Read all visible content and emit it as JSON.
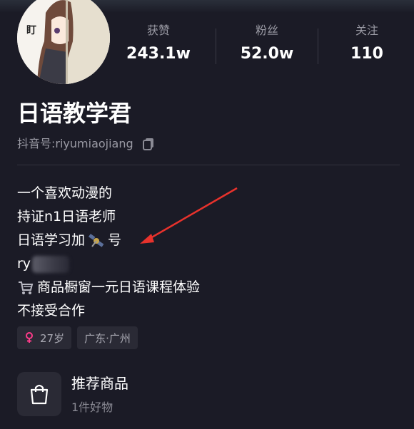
{
  "profile": {
    "avatar_text": "盯",
    "name": "日语教学君",
    "account_label": "抖音号:",
    "account_id": "riyumiaojiang"
  },
  "stats": [
    {
      "label": "获赞",
      "value": "243.1w"
    },
    {
      "label": "粉丝",
      "value": "52.0w"
    },
    {
      "label": "关注",
      "value": "110"
    }
  ],
  "bio": {
    "line1": "一个喜欢动漫的",
    "line2": "持证n1日语老师",
    "line3_before": "日语学习加",
    "line3_after": "号",
    "line4_prefix": "ry",
    "line5": "商品橱窗一元日语课程体验",
    "line6": "不接受合作",
    "line3_icon": "satellite-icon",
    "line5_icon": "shopping-cart-icon"
  },
  "tags": {
    "age": "27岁",
    "location": "广东·广州"
  },
  "recommend": {
    "title": "推荐商品",
    "subtitle": "1件好物"
  },
  "colors": {
    "background": "#1b1b26",
    "muted_text": "#9a9aa4",
    "tag_background": "#2a2a35",
    "female_icon": "#ff3b8a",
    "annotation_arrow": "#e8322c"
  }
}
